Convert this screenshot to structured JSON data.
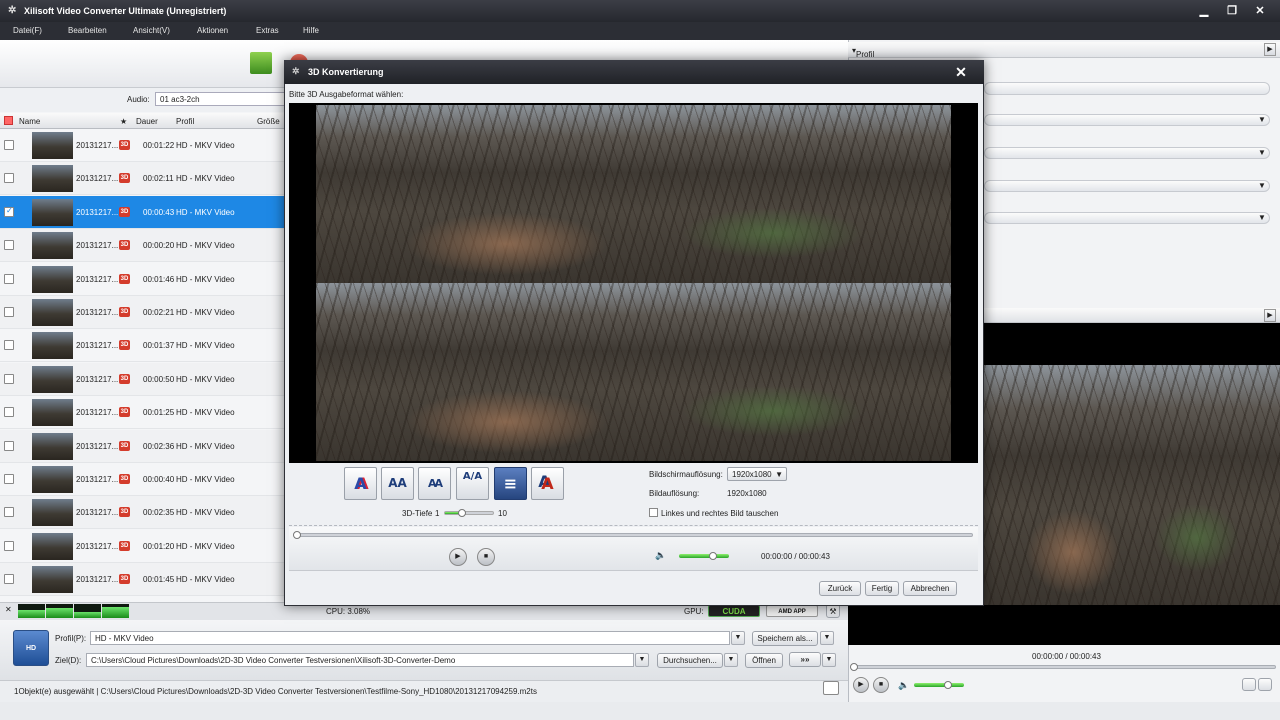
{
  "window": {
    "title": "Xilisoft Video Converter Ultimate (Unregistriert)"
  },
  "menu": [
    "Datei(F)",
    "Bearbeiten",
    "Ansicht(V)",
    "Aktionen",
    "Extras",
    "Hilfe"
  ],
  "audio": {
    "label": "Audio:",
    "value": "01 ac3-2ch"
  },
  "table": {
    "headers": {
      "name": "Name",
      "star": "★",
      "duration": "Dauer",
      "profile": "Profil",
      "size": "Größe"
    },
    "rows": [
      {
        "name": "20131217...",
        "duration": "00:01:22",
        "profile": "HD - MKV Video"
      },
      {
        "name": "20131217...",
        "duration": "00:02:11",
        "profile": "HD - MKV Video"
      },
      {
        "name": "20131217...",
        "duration": "00:00:43",
        "profile": "HD - MKV Video"
      },
      {
        "name": "20131217...",
        "duration": "00:00:20",
        "profile": "HD - MKV Video"
      },
      {
        "name": "20131217...",
        "duration": "00:01:46",
        "profile": "HD - MKV Video"
      },
      {
        "name": "20131217...",
        "duration": "00:02:21",
        "profile": "HD - MKV Video"
      },
      {
        "name": "20131217...",
        "duration": "00:01:37",
        "profile": "HD - MKV Video"
      },
      {
        "name": "20131217...",
        "duration": "00:00:50",
        "profile": "HD - MKV Video"
      },
      {
        "name": "20131217...",
        "duration": "00:01:25",
        "profile": "HD - MKV Video"
      },
      {
        "name": "20131217...",
        "duration": "00:02:36",
        "profile": "HD - MKV Video"
      },
      {
        "name": "20131217...",
        "duration": "00:00:40",
        "profile": "HD - MKV Video"
      },
      {
        "name": "20131217...",
        "duration": "00:02:35",
        "profile": "HD - MKV Video"
      },
      {
        "name": "20131217...",
        "duration": "00:01:20",
        "profile": "HD - MKV Video"
      },
      {
        "name": "20131217...",
        "duration": "00:01:45",
        "profile": "HD - MKV Video"
      }
    ]
  },
  "status": {
    "cpu": "CPU: 3.08%",
    "gpu": "GPU:",
    "cuda": "CUDA",
    "amd": "AMD APP"
  },
  "profile": {
    "label": "Profil(P):",
    "value": "HD - MKV Video",
    "save_as": "Speichern als..."
  },
  "target": {
    "label": "Ziel(D):",
    "value": "C:\\Users\\Cloud Pictures\\Downloads\\2D-3D Video Converter Testversionen\\Xilisoft-3D-Converter-Demo",
    "browse": "Durchsuchen...",
    "open": "Öffnen"
  },
  "info_text": "1Objekt(e) ausgewählt | C:\\Users\\Cloud Pictures\\Downloads\\2D-3D Video Converter Testversionen\\Testfilme-Sony_HD1080\\20131217094259.m2ts",
  "right_panel": {
    "profile_header": "Profil",
    "time": "00:00:00 / 00:00:43"
  },
  "dialog": {
    "title": "3D Konvertierung",
    "prompt": "Bitte 3D Ausgabeformat wählen:",
    "mode_buttons": [
      "A",
      "AA",
      "AA",
      "A/A",
      "≡",
      "A"
    ],
    "screen_res_label": "Bildschirmauflösung:",
    "screen_res_value": "1920x1080",
    "image_res_label": "Bildauflösung:",
    "image_res_value": "1920x1080",
    "depth_label": "3D-Tiefe",
    "depth_min": "1",
    "depth_max": "10",
    "depth_level": 0.36,
    "swap_label": "Linkes und rechtes Bild tauschen",
    "time": "00:00:00 / 00:00:43",
    "buttons": {
      "back": "Zurück",
      "done": "Fertig",
      "cancel": "Abbrechen"
    }
  }
}
